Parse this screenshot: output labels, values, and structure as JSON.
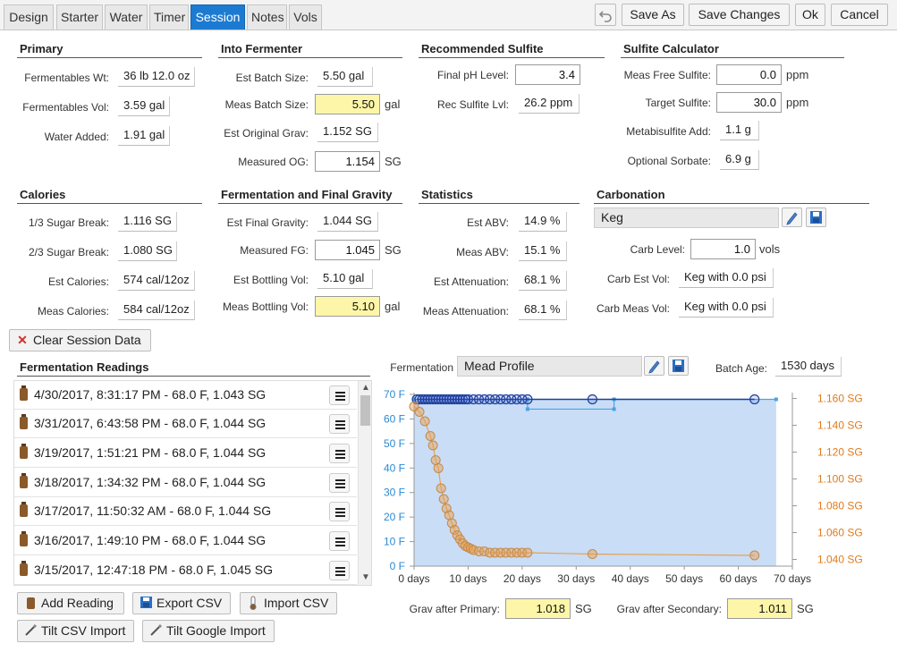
{
  "tabs": [
    "Design",
    "Starter",
    "Water",
    "Timer",
    "Session",
    "Notes",
    "Vols"
  ],
  "active_tab": "Session",
  "toolbar": {
    "undo_icon": "undo-icon",
    "save_as": "Save As",
    "save_changes": "Save Changes",
    "ok": "Ok",
    "cancel": "Cancel"
  },
  "primary": {
    "title": "Primary",
    "fermentables_wt_label": "Fermentables Wt:",
    "fermentables_wt": "36 lb 12.0 oz",
    "fermentables_vol_label": "Fermentables Vol:",
    "fermentables_vol": "3.59 gal",
    "water_added_label": "Water Added:",
    "water_added": "1.91 gal"
  },
  "into": {
    "title": "Into Fermenter",
    "est_batch_label": "Est Batch Size:",
    "est_batch": "5.50 gal",
    "meas_batch_label": "Meas Batch Size:",
    "meas_batch": "5.50",
    "meas_batch_unit": "gal",
    "est_og_label": "Est Original Grav:",
    "est_og": "1.152 SG",
    "measured_og_label": "Measured OG:",
    "measured_og": "1.154",
    "measured_og_unit": "SG"
  },
  "rec_sulfite": {
    "title": "Recommended Sulfite",
    "final_ph_label": "Final pH Level:",
    "final_ph": "3.4",
    "rec_lvl_label": "Rec Sulfite Lvl:",
    "rec_lvl": "26.2 ppm"
  },
  "sulfite_calc": {
    "title": "Sulfite Calculator",
    "meas_free_label": "Meas Free Sulfite:",
    "meas_free": "0.0",
    "meas_free_unit": "ppm",
    "target_label": "Target Sulfite:",
    "target": "30.0",
    "target_unit": "ppm",
    "meta_label": "Metabisulfite Add:",
    "meta": "1.1 g",
    "sorbate_label": "Optional Sorbate:",
    "sorbate": "6.9 g"
  },
  "calories": {
    "title": "Calories",
    "sugar13_label": "1/3 Sugar Break:",
    "sugar13": "1.116 SG",
    "sugar23_label": "2/3 Sugar Break:",
    "sugar23": "1.080 SG",
    "est_cal_label": "Est Calories:",
    "est_cal": "574 cal/12oz",
    "meas_cal_label": "Meas Calories:",
    "meas_cal": "584 cal/12oz"
  },
  "ferm_final": {
    "title": "Fermentation and Final Gravity",
    "est_fg_label": "Est Final Gravity:",
    "est_fg": "1.044 SG",
    "meas_fg_label": "Measured FG:",
    "meas_fg": "1.045",
    "meas_fg_unit": "SG",
    "est_bottling_label": "Est Bottling Vol:",
    "est_bottling": "5.10 gal",
    "meas_bottling_label": "Meas Bottling Vol:",
    "meas_bottling": "5.10",
    "meas_bottling_unit": "gal"
  },
  "statistics": {
    "title": "Statistics",
    "est_abv_label": "Est ABV:",
    "est_abv": "14.9 %",
    "meas_abv_label": "Meas ABV:",
    "meas_abv": "15.1 %",
    "est_att_label": "Est Attenuation:",
    "est_att": "68.1 %",
    "meas_att_label": "Meas Attenuation:",
    "meas_att": "68.1 %"
  },
  "carbonation": {
    "title": "Carbonation",
    "method": "Keg",
    "carb_level_label": "Carb Level:",
    "carb_level": "1.0",
    "carb_level_unit": "vols",
    "carb_est_label": "Carb Est Vol:",
    "carb_est": "Keg with 0.0 psi",
    "carb_meas_label": "Carb Meas Vol:",
    "carb_meas": "Keg with 0.0 psi"
  },
  "clear_button": "Clear Session Data",
  "readings": {
    "title": "Fermentation Readings",
    "items": [
      "4/30/2017, 8:31:17 PM - 68.0 F, 1.043 SG",
      "3/31/2017, 6:43:58 PM - 68.0 F, 1.044 SG",
      "3/19/2017, 1:51:21 PM - 68.0 F, 1.044 SG",
      "3/18/2017, 1:34:32 PM - 68.0 F, 1.044 SG",
      "3/17/2017, 11:50:32 AM - 68.0 F, 1.044 SG",
      "3/16/2017, 1:49:10 PM - 68.0 F, 1.044 SG",
      "3/15/2017, 12:47:18 PM - 68.0 F, 1.045 SG"
    ],
    "add": "Add Reading",
    "export": "Export CSV",
    "import": "Import CSV",
    "tilt_csv": "Tilt CSV Import",
    "tilt_google": "Tilt Google Import"
  },
  "fermentation": {
    "label": "Fermentation",
    "profile": "Mead Profile",
    "batch_age_label": "Batch Age:",
    "batch_age": "1530 days",
    "grav_primary_label": "Grav after Primary:",
    "grav_primary": "1.018",
    "grav_primary_unit": "SG",
    "grav_secondary_label": "Grav after Secondary:",
    "grav_secondary": "1.011",
    "grav_secondary_unit": "SG"
  },
  "chart_data": {
    "type": "scatter",
    "x_ticks": [
      "0 days",
      "10 days",
      "20 days",
      "30 days",
      "40 days",
      "50 days",
      "60 days",
      "70 days"
    ],
    "xlim": [
      0,
      70
    ],
    "y_left_ticks": [
      "70 F",
      "60 F",
      "50 F",
      "40 F",
      "30 F",
      "20 F",
      "10 F",
      "0 F"
    ],
    "ylim_left": [
      0,
      70
    ],
    "y_right_ticks": [
      "1.160 SG",
      "1.140 SG",
      "1.120 SG",
      "1.100 SG",
      "1.080 SG",
      "1.060 SG",
      "1.040 SG"
    ],
    "ylim_right": [
      1.035,
      1.163
    ],
    "series": [
      {
        "values_x": [
          0.5,
          1,
          1.5,
          2,
          2.5,
          3,
          3.5,
          4,
          4.5,
          5,
          5.5,
          6,
          6.5,
          7,
          7.5,
          8,
          8.5,
          9,
          9.5,
          10,
          11,
          12,
          13,
          14,
          15,
          16,
          17,
          18,
          19,
          20,
          21,
          33,
          63
        ],
        "values_y": [
          68,
          68,
          68,
          68,
          68,
          68,
          68,
          68,
          68,
          68,
          68,
          68,
          68,
          68,
          68,
          68,
          68,
          68,
          68,
          68,
          68,
          68,
          68,
          68,
          68,
          68,
          68,
          68,
          68,
          68,
          68,
          68,
          68
        ],
        "color": "#1c3f9c"
      },
      {
        "values_x": [
          0,
          1,
          2,
          3,
          3.5,
          4,
          4.5,
          5,
          5.5,
          6,
          6.5,
          7,
          7.5,
          8,
          8.5,
          9,
          9.5,
          10,
          10.5,
          11,
          12,
          13,
          14,
          15,
          16,
          17,
          18,
          19,
          20,
          21,
          33,
          63
        ],
        "values_y": [
          1.154,
          1.15,
          1.143,
          1.132,
          1.125,
          1.114,
          1.108,
          1.093,
          1.085,
          1.078,
          1.073,
          1.067,
          1.062,
          1.058,
          1.055,
          1.052,
          1.05,
          1.049,
          1.048,
          1.047,
          1.046,
          1.046,
          1.045,
          1.045,
          1.045,
          1.045,
          1.045,
          1.045,
          1.045,
          1.045,
          1.044,
          1.043
        ],
        "color": "#e8a050"
      }
    ],
    "profile_temp_x": [
      0,
      21,
      21,
      37,
      37,
      67
    ],
    "profile_temp_y": [
      68,
      68,
      64,
      64,
      68,
      68
    ],
    "colors": {
      "fill": "#c9ddf6",
      "temp_profile": "#4aa3e3",
      "temp_points": "#1c3f9c",
      "gravity": "#e8a050"
    }
  }
}
